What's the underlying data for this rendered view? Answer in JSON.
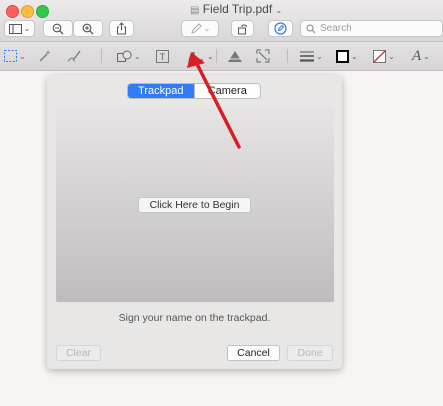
{
  "window": {
    "title": "Field Trip.pdf",
    "traffic_lights": {
      "close": "#fc605b",
      "minimize": "#fdbc40",
      "zoom": "#34c84a"
    }
  },
  "toolbar": {
    "icons": [
      "sidebar-icon",
      "zoom-out-icon",
      "zoom-in-icon",
      "share-icon",
      "pen-icon",
      "rotate-icon",
      "markup-icon"
    ],
    "search": {
      "placeholder": "Search"
    }
  },
  "markup_toolbar": {
    "icons": [
      "rectangular-selection-icon",
      "instant-alpha-icon",
      "sketch-icon",
      "shapes-icon",
      "text-icon",
      "sign-icon",
      "adjust-color-icon",
      "adjust-size-icon",
      "shape-style-icon",
      "border-color-icon",
      "fill-color-icon",
      "text-style-icon"
    ]
  },
  "signature_sheet": {
    "tabs": [
      {
        "label": "Trackpad",
        "selected": true
      },
      {
        "label": "Camera",
        "selected": false
      }
    ],
    "begin_button": "Click Here to Begin",
    "hint": "Sign your name on the trackpad.",
    "clear_button": "Clear",
    "cancel_button": "Cancel",
    "done_button": "Done"
  },
  "annotation": {
    "arrow_color": "#d81f26"
  }
}
